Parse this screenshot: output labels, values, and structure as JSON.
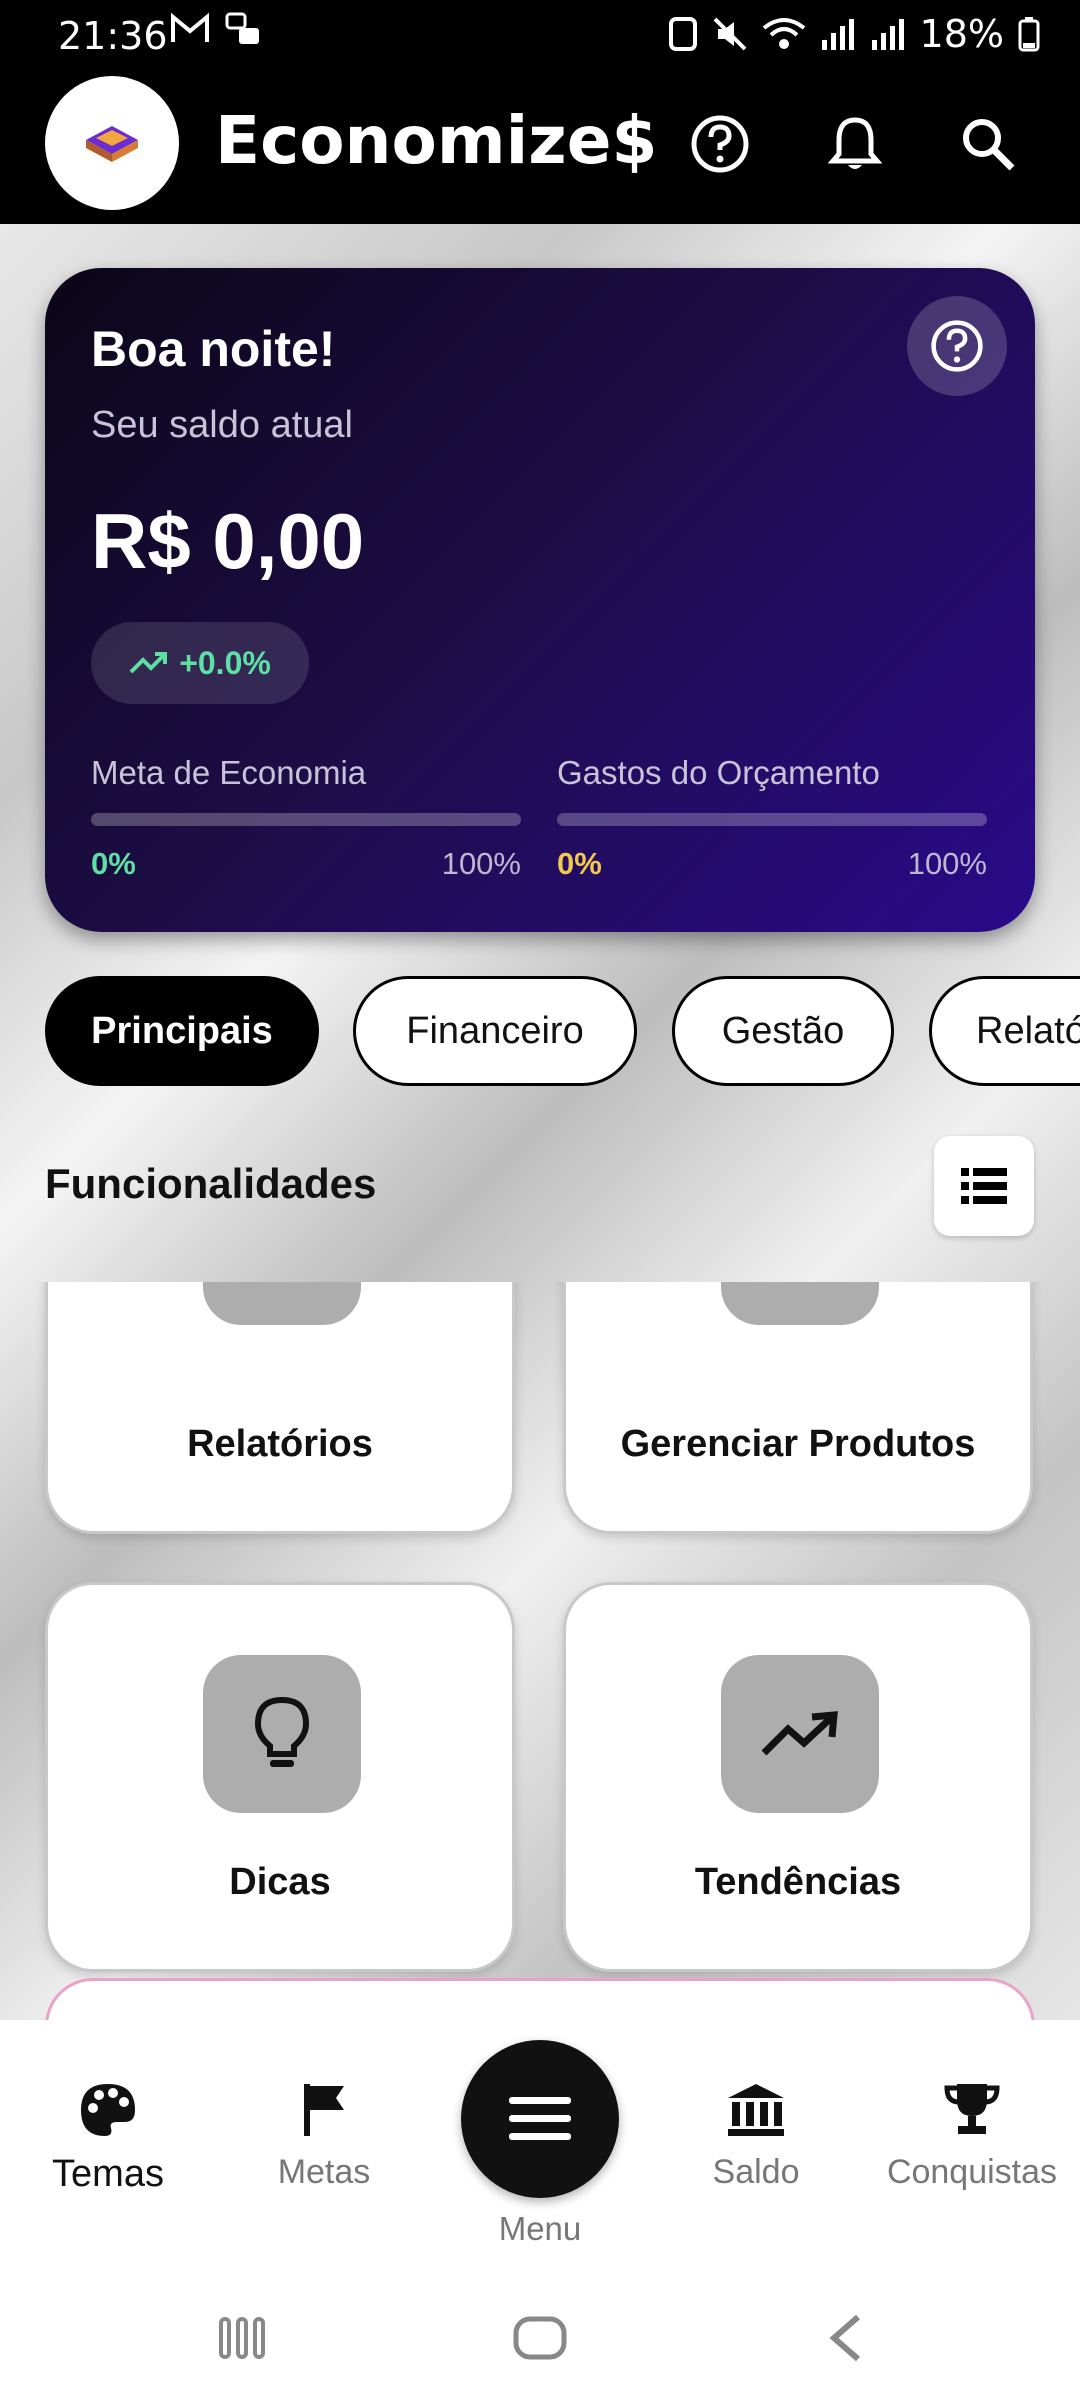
{
  "status_bar": {
    "time": "21:36",
    "battery": "18%"
  },
  "header": {
    "title": "Economize$"
  },
  "balance_card": {
    "greeting": "Boa noite!",
    "subtitle": "Seu saldo atual",
    "amount": "R$ 0,00",
    "trend": "+0.0%",
    "savings_goal": {
      "label": "Meta de Economia",
      "percent_label": "0%",
      "max_label": "100%",
      "progress": 0
    },
    "budget_spent": {
      "label": "Gastos do Orçamento",
      "percent_label": "0%",
      "max_label": "100%",
      "progress": 0
    }
  },
  "category_tabs": [
    "Principais",
    "Financeiro",
    "Gestão",
    "Relatórios"
  ],
  "section": {
    "title": "Funcionalidades"
  },
  "features": [
    {
      "label": "Relatórios",
      "icon": "bar-chart-icon"
    },
    {
      "label": "Gerenciar Produtos",
      "icon": "box-icon"
    },
    {
      "label": "Dicas",
      "icon": "lightbulb-icon"
    },
    {
      "label": "Tendências",
      "icon": "trending-up-icon"
    }
  ],
  "bottom_nav": {
    "items": [
      {
        "label": "Temas",
        "icon": "palette-icon"
      },
      {
        "label": "Metas",
        "icon": "flag-icon"
      },
      {
        "label": "Menu",
        "icon": "menu-icon"
      },
      {
        "label": "Saldo",
        "icon": "bank-icon"
      },
      {
        "label": "Conquistas",
        "icon": "trophy-icon"
      }
    ]
  },
  "colors": {
    "accent_green": "#5ee0a4",
    "accent_yellow": "#f2c94c",
    "card_purple": "#2a0a8a"
  }
}
